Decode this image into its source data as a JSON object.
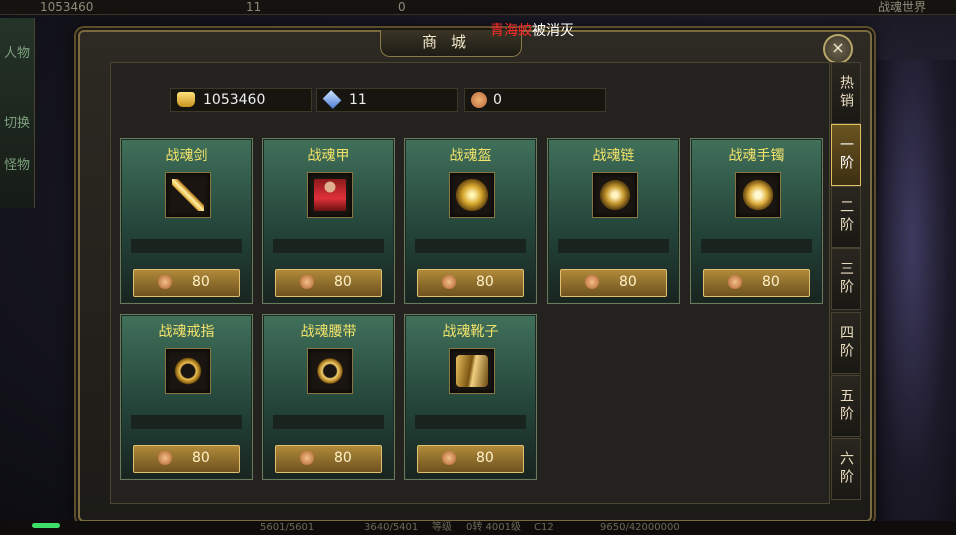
{
  "top_hud": {
    "gold": "1053460",
    "count": "11",
    "zero": "0",
    "server": "战魂世界"
  },
  "notice": {
    "name": "青海蛟",
    "text": "被消灭"
  },
  "window": {
    "title": "商城",
    "close": "×"
  },
  "currencies": [
    {
      "icon": "gold-ingot-icon",
      "value": "1053460"
    },
    {
      "icon": "blue-gem-icon",
      "value": "11"
    },
    {
      "icon": "coin-icon",
      "value": "0"
    }
  ],
  "items": [
    {
      "name": "战魂剑",
      "price": "80"
    },
    {
      "name": "战魂甲",
      "price": "80"
    },
    {
      "name": "战魂盔",
      "price": "80"
    },
    {
      "name": "战魂链",
      "price": "80"
    },
    {
      "name": "战魂手镯",
      "price": "80"
    },
    {
      "name": "战魂戒指",
      "price": "80"
    },
    {
      "name": "战魂腰带",
      "price": "80"
    },
    {
      "name": "战魂靴子",
      "price": "80"
    }
  ],
  "tabs": [
    "热销",
    "一阶",
    "二阶",
    "三阶",
    "四阶",
    "五阶",
    "六阶"
  ],
  "active_tab": 1,
  "left_bar": [
    "人物",
    "切换",
    "怪物"
  ],
  "bottom_hud": [
    "5601/5601",
    "3640/5401",
    "等级",
    "0转 4001级",
    "C12",
    "9650/42000000"
  ],
  "colors": {
    "item_name": "#f3e36a",
    "notice_red": "#ff2a2a",
    "active_tab": "#6a5420"
  }
}
